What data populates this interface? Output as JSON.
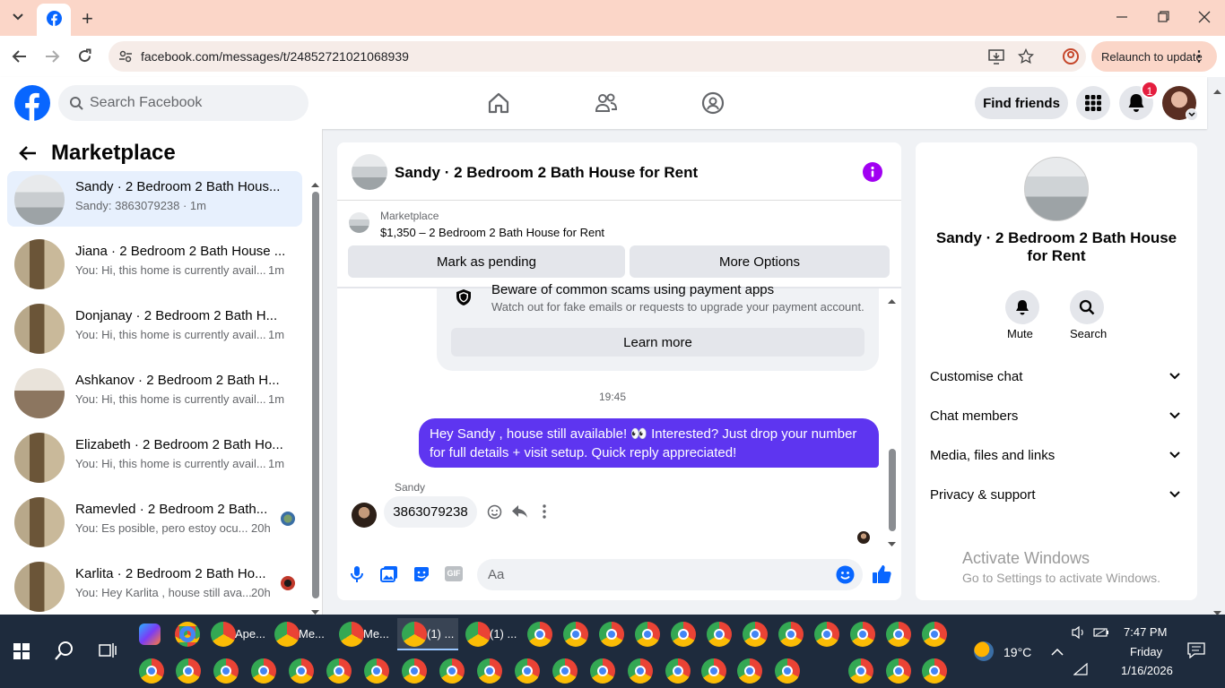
{
  "browser": {
    "url": "facebook.com/messages/t/24852721021068939",
    "relaunch_label": "Relaunch to update",
    "new_tab": "+",
    "window_controls": [
      "minimize",
      "maximize",
      "close"
    ]
  },
  "fb": {
    "search_placeholder": "Search Facebook",
    "find_friends": "Find friends",
    "notification_count": "1"
  },
  "sidebar": {
    "title": "Marketplace",
    "conversations": [
      {
        "title": "Sandy · 2 Bedroom 2 Bath Hous...",
        "preview": "Sandy: 3863079238 · 1m",
        "time": "",
        "active": true
      },
      {
        "title": "Jiana · 2 Bedroom 2 Bath House ...",
        "preview": "You: Hi, this home is currently avail...",
        "time": "1m"
      },
      {
        "title": "Donjanay · 2 Bedroom 2 Bath H...",
        "preview": "You: Hi, this home is currently avail...",
        "time": "1m"
      },
      {
        "title": "Ashkanov · 2 Bedroom 2 Bath H...",
        "preview": "You: Hi, this home is currently avail...",
        "time": "1m"
      },
      {
        "title": "Elizabeth · 2 Bedroom 2 Bath Ho...",
        "preview": "You: Hi, this home is currently avail...",
        "time": "1m"
      },
      {
        "title": "Ramevled · 2 Bedroom 2 Bath...",
        "preview": "You: Es posible, pero estoy ocu...",
        "time": "20h"
      },
      {
        "title": "Karlita · 2 Bedroom 2 Bath Ho...",
        "preview": "You: Hey Karlita , house still ava...",
        "time": "20h"
      }
    ]
  },
  "chat": {
    "header_title": "Sandy · 2 Bedroom 2 Bath House for Rent",
    "listing_source": "Marketplace",
    "listing_text": "$1,350 – 2 Bedroom 2 Bath House for Rent",
    "mark_pending": "Mark as pending",
    "more_options": "More Options",
    "scam_title": "Beware of common scams using payment apps",
    "scam_body": "Watch out for fake emails or requests to upgrade your payment account.",
    "learn_more": "Learn more",
    "timestamp": "19:45",
    "outgoing_message": "Hey Sandy , house still available! 👀 Interested? Just drop your number for full details + visit setup. Quick reply appreciated!",
    "sender_name": "Sandy",
    "incoming_message": "3863079238",
    "composer_placeholder": "Aa",
    "gif_label": "GIF"
  },
  "details": {
    "title": "Sandy · 2 Bedroom 2 Bath House for Rent",
    "mute": "Mute",
    "search": "Search",
    "sections": [
      "Customise chat",
      "Chat members",
      "Media, files and links",
      "Privacy & support"
    ],
    "watermark_title": "Activate Windows",
    "watermark_body": "Go to Settings to activate Windows."
  },
  "taskbar": {
    "apps_row1": [
      "Ape...",
      "Me...",
      "Me...",
      "(1) ...",
      "(1) ..."
    ],
    "weather_temp": "19°C",
    "time": "7:47 PM",
    "day": "Friday",
    "date": "1/16/2026"
  },
  "colors": {
    "fb_blue": "#0866ff",
    "bubble_purple": "#5e35f0",
    "tab_strip": "#fbd6c8",
    "taskbar": "#1e2b3d"
  }
}
